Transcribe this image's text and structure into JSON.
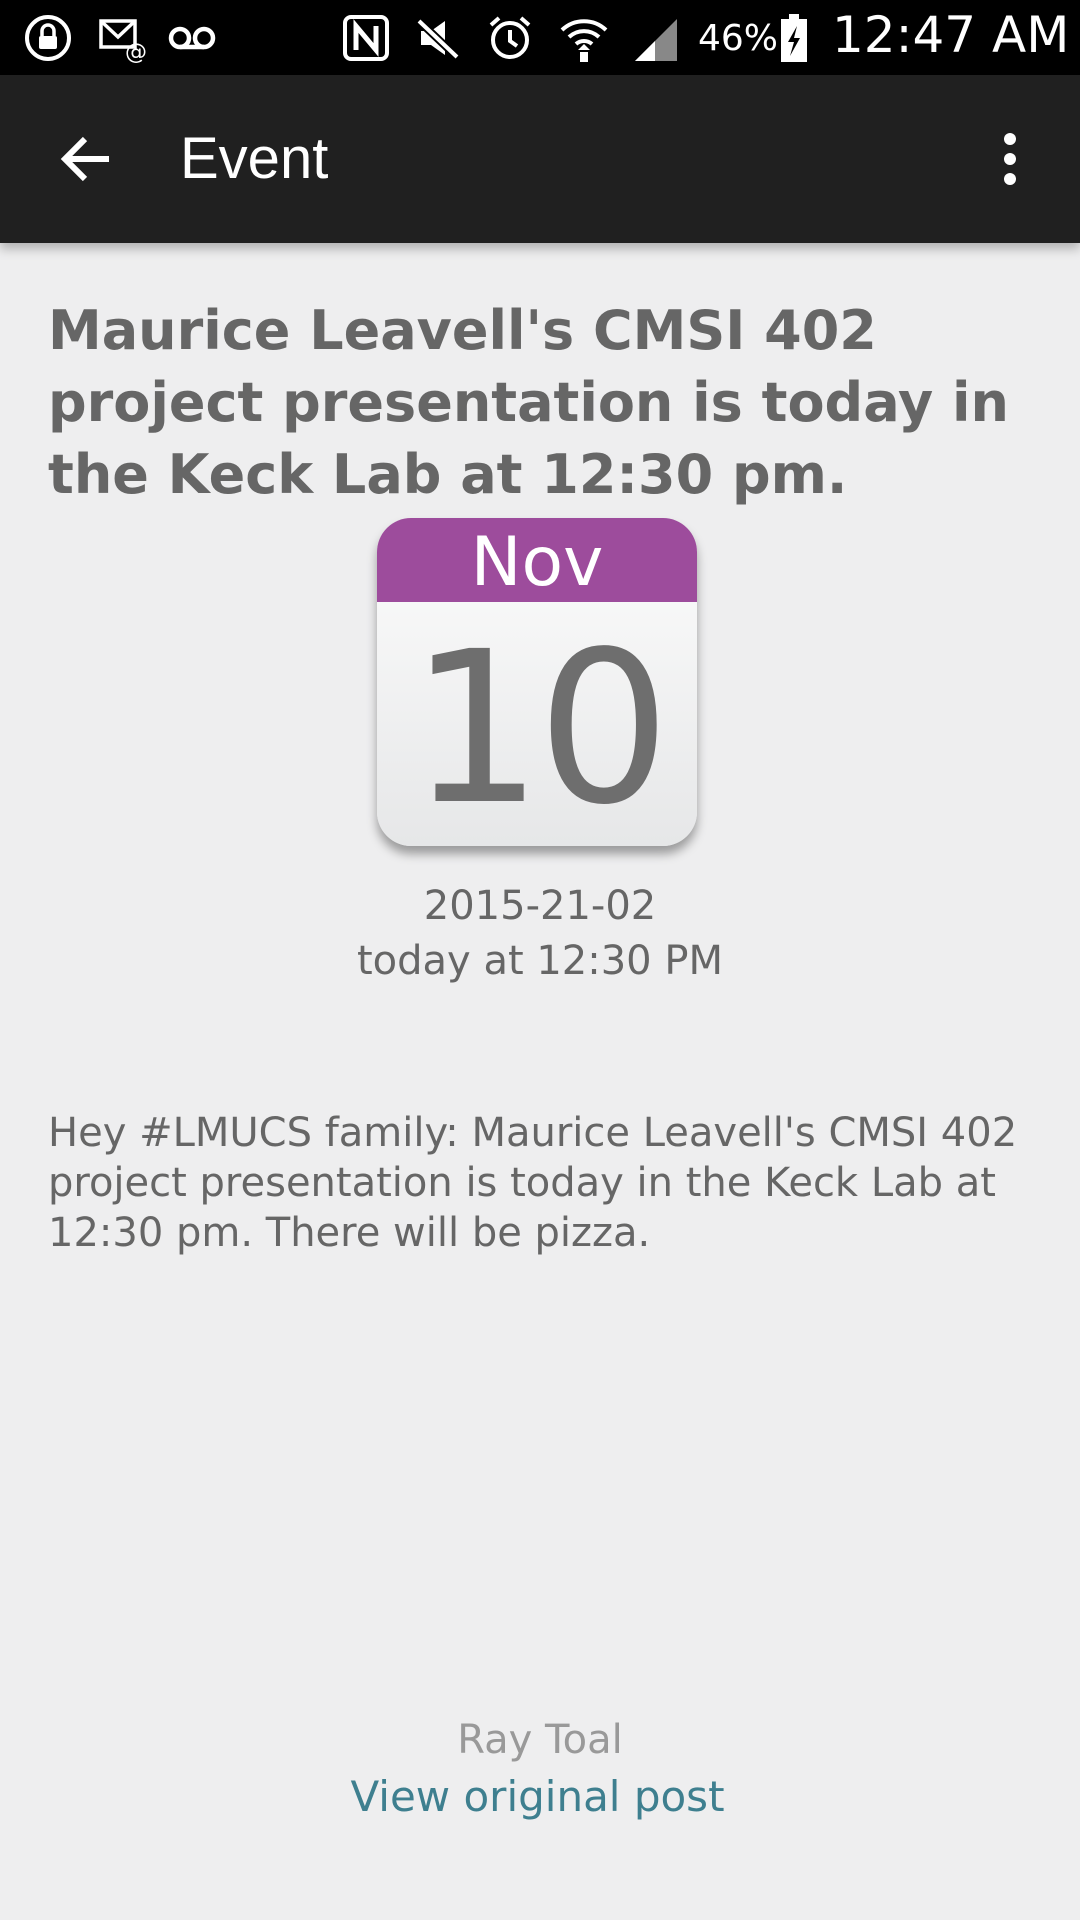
{
  "status_bar": {
    "battery": "46%",
    "time": "12:47 AM",
    "icons": [
      "lock-icon",
      "email-icon",
      "voicemail-icon",
      "nfc-icon",
      "mute-icon",
      "alarm-icon",
      "wifi-icon",
      "signal-icon",
      "battery-icon"
    ]
  },
  "app_bar": {
    "title": "Event",
    "back_icon": "arrow-back-icon",
    "menu_icon": "more-vert-icon"
  },
  "event": {
    "headline": "Maurice Leavell's CMSI 402 project presentation is today in the Keck Lab at 12:30 pm.",
    "calendar": {
      "month": "Nov",
      "day": "10",
      "accent_color": "#9d4c9c"
    },
    "date": "2015-21-02",
    "time": "today at 12:30 PM",
    "body": "Hey #LMUCS family: Maurice Leavell's CMSI 402 project presentation is today in the Keck Lab at 12:30 pm. There will be pizza.",
    "author": "Ray Toal",
    "link_label": "View original post",
    "link_color": "#3e7f8f"
  }
}
